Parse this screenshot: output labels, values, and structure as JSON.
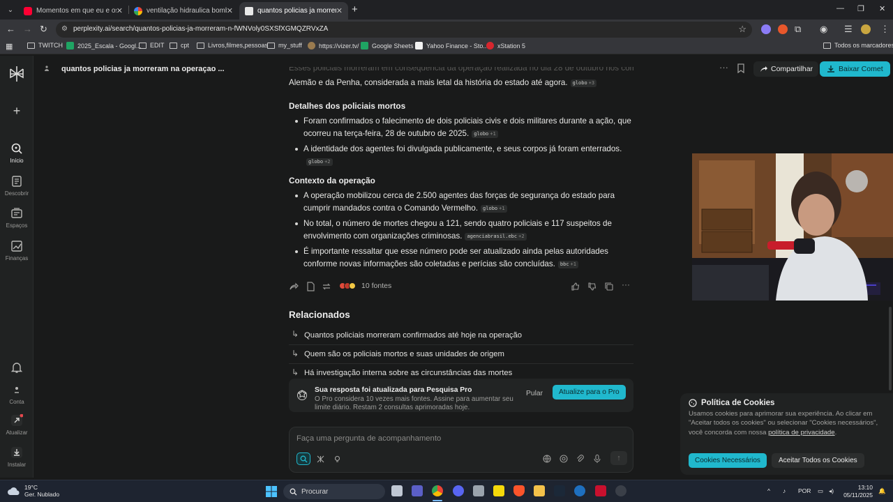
{
  "browser": {
    "tabs": [
      {
        "title": "Momentos em que eu e os policiais",
        "favicon_color": "#ff0033"
      },
      {
        "title": "ventilação hidraulica bombeiro",
        "favicon_color": "#4285f4"
      },
      {
        "title": "quantos policias ja morreram n",
        "favicon_color": "#e8e8e8",
        "active": true
      }
    ],
    "url": "perplexity.ai/search/quantos-policias-ja-morreram-n-fWNVoly0SXSfXGMQZRVxZA",
    "bookmarks": [
      "TWITCH",
      "2025_Escala - Googl...",
      "EDIT",
      "cpt",
      "Livros,filmes,pessoas",
      "my_stuff",
      "https://vizer.tv/",
      "Google Sheets",
      "Yahoo Finance - Sto...",
      "xStation 5"
    ],
    "all_bookmarks": "Todos os marcadores"
  },
  "rail": {
    "items": [
      {
        "label": "Início",
        "icon": "search-icon"
      },
      {
        "label": "Descobrir",
        "icon": "newspaper-icon"
      },
      {
        "label": "Espaços",
        "icon": "spaces-icon"
      },
      {
        "label": "Finanças",
        "icon": "chart-icon"
      }
    ],
    "bottom": [
      {
        "label": "",
        "icon": "bell-icon"
      },
      {
        "label": "Conta",
        "icon": "user-icon"
      },
      {
        "label": "Atualizar",
        "icon": "upgrade-icon"
      },
      {
        "label": "Instalar",
        "icon": "download-icon"
      }
    ]
  },
  "header": {
    "title": "quantos policias ja morreram na operaçao ...",
    "share": "Compartilhar",
    "download": "Baixar Comet"
  },
  "answer": {
    "faded_line": "Esses policiais morreram em consequência da operação realizada no dia 28 de outubro nos complexos do",
    "intro_line": "Alemão e da Penha, considerada a mais letal da história do estado até agora.",
    "intro_cite": {
      "src": "globo",
      "n": "+3"
    },
    "sections": [
      {
        "heading": "Detalhes dos policiais mortos",
        "items": [
          {
            "text": "Foram confirmados o falecimento de dois policiais civis e dois militares durante a ação, que ocorreu na terça-feira, 28 de outubro de 2025.",
            "cite": "globo",
            "n": "+1"
          },
          {
            "text": "A identidade dos agentes foi divulgada publicamente, e seus corpos já foram enterrados.",
            "cite": "globo",
            "n": "+2"
          }
        ]
      },
      {
        "heading": "Contexto da operação",
        "items": [
          {
            "text": "A operação mobilizou cerca de 2.500 agentes das forças de segurança do estado para cumprir mandados contra o Comando Vermelho.",
            "cite": "globo",
            "n": "+1"
          },
          {
            "text": "No total, o número de mortes chegou a 121, sendo quatro policiais e 117 suspeitos de envolvimento com organizações criminosas.",
            "cite": "agenciabrasil.ebc",
            "n": "+2"
          },
          {
            "text": "É importante ressaltar que esse número pode ser atualizado ainda pelas autoridades conforme novas informações são coletadas e perícias são concluídas.",
            "cite": "bbc",
            "n": "+1"
          }
        ]
      }
    ],
    "sources_label": "10 fontes"
  },
  "related": {
    "title": "Relacionados",
    "items": [
      "Quantos policiais morreram confirmados até hoje na operação",
      "Quem são os policiais mortos e suas unidades de origem",
      "Há investigação interna sobre as circunstâncias das mortes"
    ]
  },
  "pro_banner": {
    "title": "Sua resposta foi atualizada para Pesquisa Pro",
    "body": "O Pro considera 10 vezes mais fontes. Assine para aumentar seu limite diário. Restam 2 consultas aprimoradas hoje.",
    "skip": "Pular",
    "upgrade": "Atualize para o Pro"
  },
  "ask": {
    "placeholder": "Faça uma pergunta de acompanhamento"
  },
  "cookie": {
    "title": "Política de Cookies",
    "body": "Usamos cookies para aprimorar sua experiência. Ao clicar em \"Aceitar todos os cookies\" ou selecionar \"Cookies necessários\", você concorda com nossa",
    "link": "política de privacidade",
    "period": ".",
    "necessary": "Cookies Necessários",
    "accept_all": "Aceitar Todos os Cookies"
  },
  "taskbar": {
    "temp": "19°C",
    "weather": "Ger. Nublado",
    "search": "Procurar",
    "lang": "POR",
    "time": "13:10",
    "date": "05/11/2025"
  },
  "colors": {
    "accent": "#20b8cd",
    "background": "#191a1a"
  }
}
